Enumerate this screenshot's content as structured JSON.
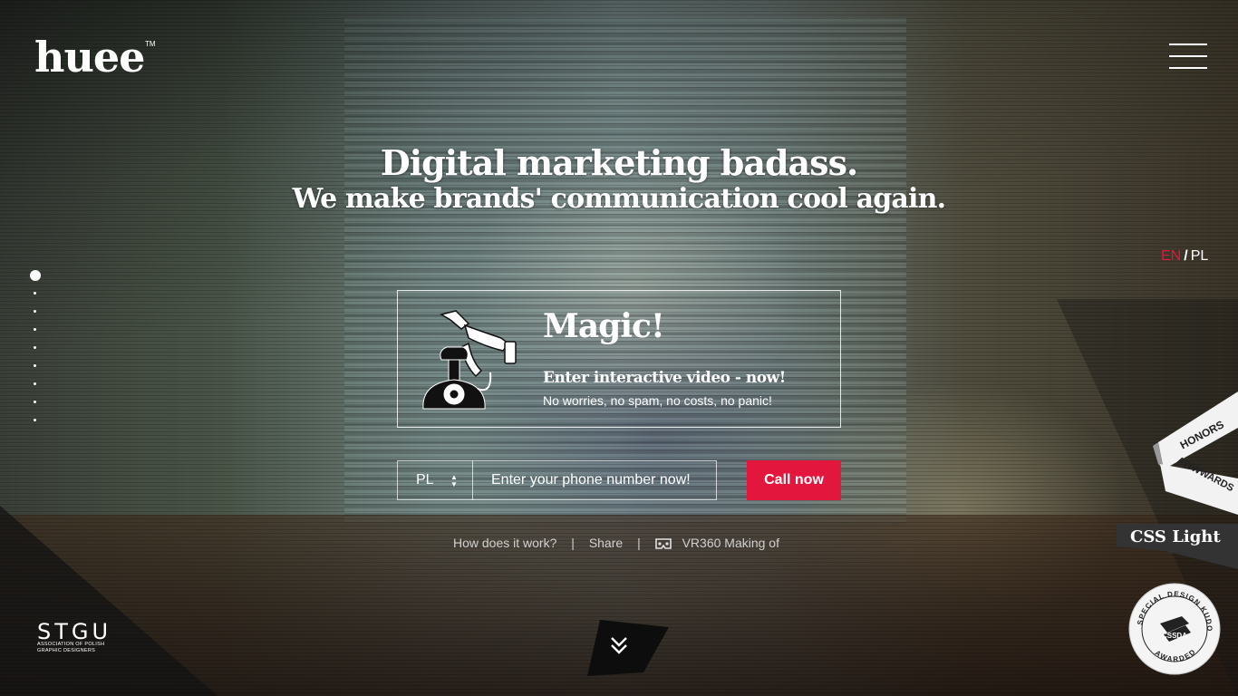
{
  "brand": {
    "logo": "huee",
    "trademark": "TM"
  },
  "header": {
    "menu_icon": "hamburger-icon"
  },
  "hero": {
    "line1": "Digital marketing badass.",
    "line2": "We make brands' communication cool again."
  },
  "lang": {
    "active": "EN",
    "separator": "/",
    "other": "PL"
  },
  "magic": {
    "title": "Magic!",
    "subtitle": "Enter interactive video - now!",
    "note": "No worries, no spam, no costs, no panic!"
  },
  "form": {
    "country": "PL",
    "phone_placeholder": "Enter your phone number now!",
    "call_label": "Call now"
  },
  "links": {
    "how": "How does it work?",
    "sep1": "|",
    "share": "Share",
    "sep2": "|",
    "vr": "VR360 Making of"
  },
  "stgu": {
    "name": "STGU",
    "line1": "ASSOCIATION OF POLISH",
    "line2": "GRAPHIC DESIGNERS"
  },
  "awards": {
    "honors": "HONORS",
    "awwwards": "AWWWARDS",
    "css_light": "CSS Light",
    "cssda_top": "SPECIAL DESIGN KUDOS",
    "cssda_mid": "CSSDA",
    "cssda_bottom": "AWARDED"
  },
  "colors": {
    "accent": "#e3173e"
  }
}
